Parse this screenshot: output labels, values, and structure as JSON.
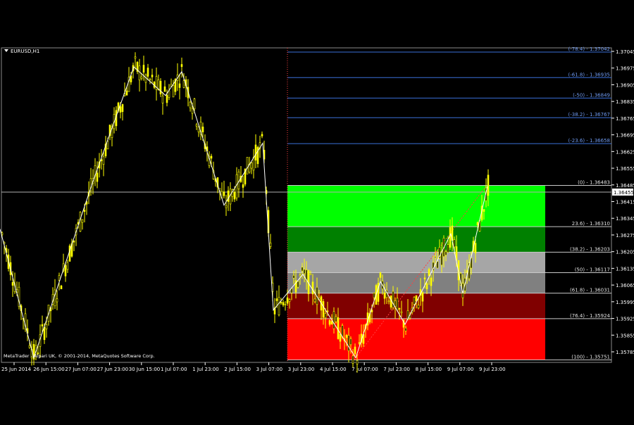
{
  "chart_data": {
    "type": "candlestick",
    "symbol_label": "EURUSD,H1",
    "footer": "MetaTrader - Alpari UK, © 2001-2014, MetaQuotes Software Corp.",
    "ylim": [
      1.357,
      1.371
    ],
    "y_ticks": [
      "1.37045",
      "1.36975",
      "1.36905",
      "1.36835",
      "1.36765",
      "1.36695",
      "1.36625",
      "1.36555",
      "1.36485",
      "1.36415",
      "1.36345",
      "1.36275",
      "1.36205",
      "1.36135",
      "1.36065",
      "1.35995",
      "1.35925",
      "1.35855",
      "1.35785"
    ],
    "current_price": "1.36455",
    "x_ticks": [
      "25 Jun 2014",
      "26 Jun 15:00",
      "27 Jun 07:00",
      "27 Jun 23:00",
      "30 Jun 15:00",
      "1 Jul 07:00",
      "1 Jul 23:00",
      "2 Jul 15:00",
      "3 Jul 07:00",
      "3 Jul 23:00",
      "4 Jul 15:00",
      "7 Jul 07:00",
      "7 Jul 23:00",
      "8 Jul 15:00",
      "9 Jul 07:00",
      "9 Jul 23:00"
    ],
    "fib_levels": [
      {
        "label": "(-78.4) - 1.37042",
        "price": 1.37042,
        "color": "#3a6fd8"
      },
      {
        "label": "(-61.8) - 1.36935",
        "price": 1.36935,
        "color": "#3a6fd8"
      },
      {
        "label": "(-50) - 1.36849",
        "price": 1.36849,
        "color": "#3a6fd8"
      },
      {
        "label": "(-38.2) - 1.36767",
        "price": 1.36767,
        "color": "#3a6fd8"
      },
      {
        "label": "(-23.6) - 1.36658",
        "price": 1.36658,
        "color": "#3a6fd8"
      },
      {
        "label": "(0) - 1.36483",
        "price": 1.36483,
        "color": "#c8c8c8"
      },
      {
        "label": "23.6) - 1.36310",
        "price": 1.3631,
        "color": "#c8c8c8"
      },
      {
        "label": "(38.2) - 1.36203",
        "price": 1.36203,
        "color": "#c8c8c8"
      },
      {
        "label": "(50) - 1.36117",
        "price": 1.36117,
        "color": "#c8c8c8"
      },
      {
        "label": "(61.8) - 1.36031",
        "price": 1.36031,
        "color": "#c8c8c8"
      },
      {
        "label": "(76.4) - 1.35924",
        "price": 1.35924,
        "color": "#c8c8c8"
      },
      {
        "label": "(100) - 1.35751",
        "price": 1.35751,
        "color": "#c8c8c8"
      }
    ],
    "zones": [
      {
        "from": 1.36483,
        "to": 1.3631,
        "color": "#00ff00"
      },
      {
        "from": 1.3631,
        "to": 1.36203,
        "color": "#008000"
      },
      {
        "from": 1.36203,
        "to": 1.36117,
        "color": "#a6a6a6"
      },
      {
        "from": 1.36117,
        "to": 1.36031,
        "color": "#808080"
      },
      {
        "from": 1.36031,
        "to": 1.35924,
        "color": "#800000"
      },
      {
        "from": 1.35924,
        "to": 1.35751,
        "color": "#ff0000"
      }
    ],
    "zigzag": [
      {
        "x": 0,
        "y": 1.363
      },
      {
        "x": 48,
        "y": 1.3576
      },
      {
        "x": 132,
        "y": 1.365
      },
      {
        "x": 190,
        "y": 1.3698
      },
      {
        "x": 235,
        "y": 1.3686
      },
      {
        "x": 258,
        "y": 1.3696
      },
      {
        "x": 318,
        "y": 1.364
      },
      {
        "x": 373,
        "y": 1.3666
      },
      {
        "x": 388,
        "y": 1.3596
      },
      {
        "x": 430,
        "y": 1.3611
      },
      {
        "x": 505,
        "y": 1.3576
      },
      {
        "x": 540,
        "y": 1.3608
      },
      {
        "x": 575,
        "y": 1.359
      },
      {
        "x": 640,
        "y": 1.3628
      },
      {
        "x": 657,
        "y": 1.3603
      },
      {
        "x": 692,
        "y": 1.3648
      }
    ],
    "colors": {
      "background": "#000000",
      "candle": "#ffff00",
      "grid_line": "#c8c8c8",
      "fib_extension": "#3a6fd8",
      "trend": "#ff4040",
      "zigzag": "#ffffff"
    }
  }
}
